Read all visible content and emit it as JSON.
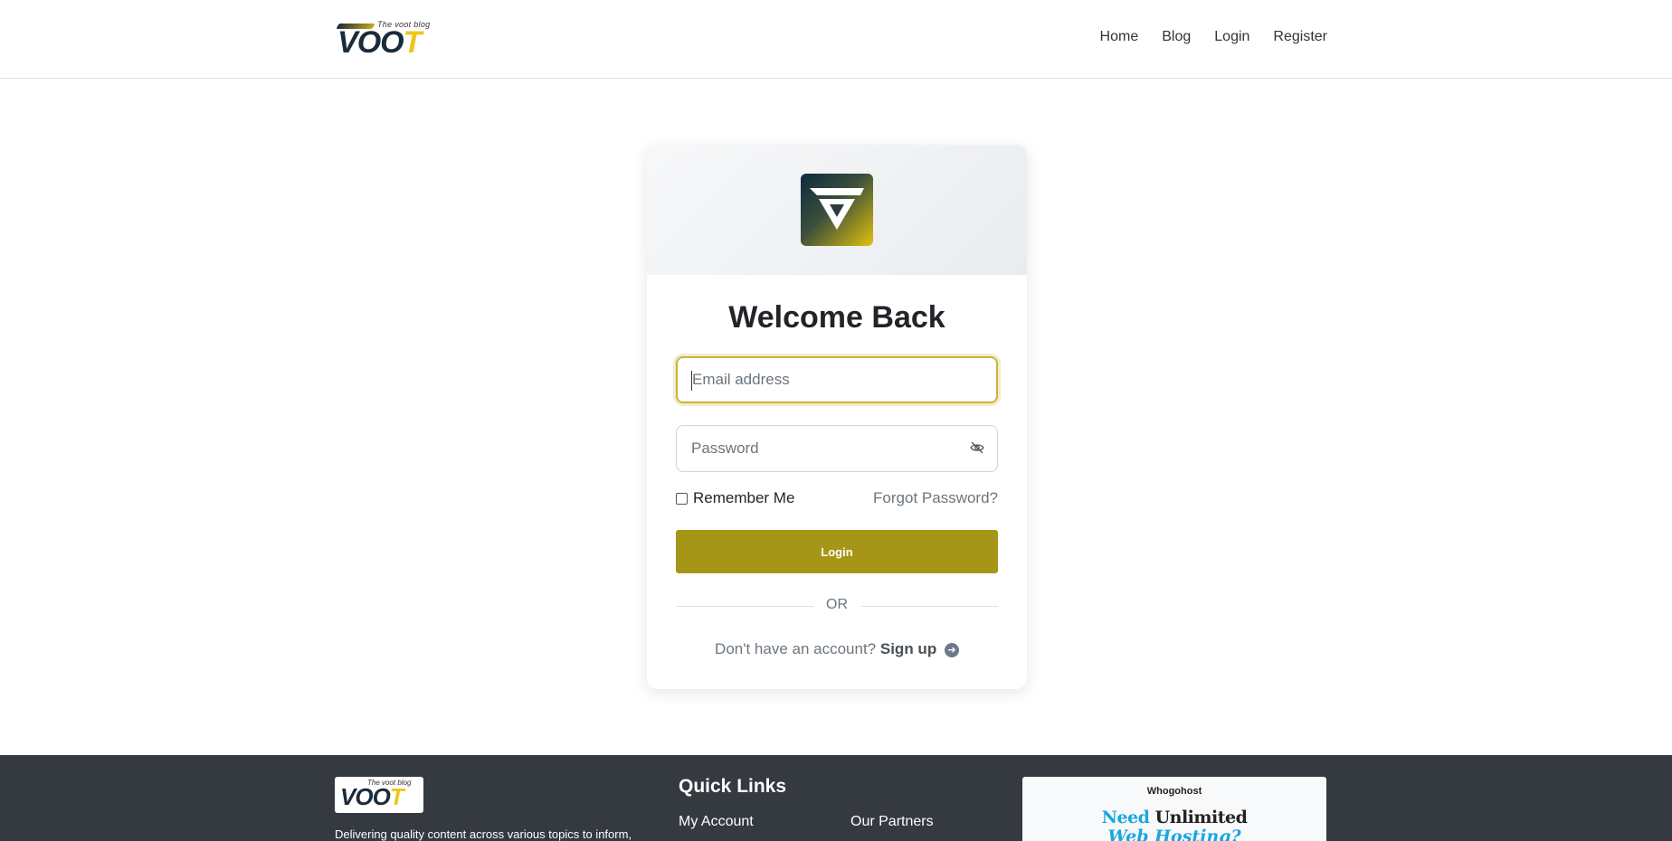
{
  "header": {
    "logo_tagline": "The voot blog",
    "logo_word_v": "V",
    "logo_word_oo": "OO",
    "logo_word_t": "T",
    "nav": [
      {
        "label": "Home"
      },
      {
        "label": "Blog"
      },
      {
        "label": "Login"
      },
      {
        "label": "Register"
      }
    ]
  },
  "login": {
    "title": "Welcome Back",
    "email_placeholder": "Email address",
    "password_placeholder": "Password",
    "remember_label": "Remember Me",
    "forgot_label": "Forgot Password?",
    "login_button": "Login",
    "or_text": "OR",
    "signup_prompt": "Don't have an account?",
    "signup_link": "Sign up",
    "signup_icon": "arrow-right-circle-icon",
    "password_toggle_icon": "eye-slash-icon",
    "accent_color": "#a69617"
  },
  "footer": {
    "logo_tagline": "The voot blog",
    "logo_word_v": "V",
    "logo_word_oo": "OO",
    "logo_word_t": "T",
    "description": "Delivering quality content across various topics to inform,",
    "quick_links_title": "Quick Links",
    "quick_links": [
      {
        "label": "My Account"
      },
      {
        "label": "Our Partners"
      }
    ],
    "ad": {
      "brand": "Whogohost",
      "headline_blue": "Need",
      "headline_dark": "Unlimited",
      "headline_line2": "Web Hosting?"
    }
  }
}
